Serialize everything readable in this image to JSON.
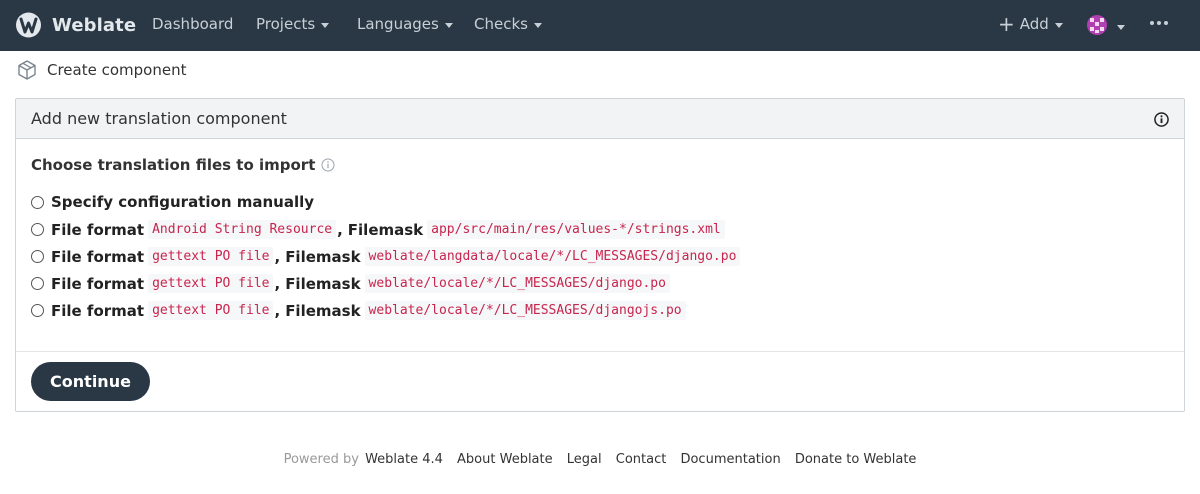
{
  "navbar": {
    "brand": "Weblate",
    "items": [
      {
        "label": "Dashboard",
        "dropdown": false
      },
      {
        "label": "Projects",
        "dropdown": true
      },
      {
        "label": "Languages",
        "dropdown": true
      },
      {
        "label": "Checks",
        "dropdown": true
      }
    ],
    "add_label": "Add",
    "colors": {
      "background": "#2a3744",
      "text": "#c8d0d7"
    }
  },
  "breadcrumb": {
    "label": "Create component",
    "icon": "cube-icon"
  },
  "panel": {
    "title": "Add new translation component",
    "heading": "Choose translation files to import",
    "options": [
      {
        "type": "manual",
        "label": "Specify configuration manually"
      },
      {
        "type": "file",
        "format_label": "File format",
        "format": "Android String Resource",
        "filemask_label": "Filemask",
        "filemask": "app/src/main/res/values-*/strings.xml"
      },
      {
        "type": "file",
        "format_label": "File format",
        "format": "gettext PO file",
        "filemask_label": "Filemask",
        "filemask": "weblate/langdata/locale/*/LC_MESSAGES/django.po"
      },
      {
        "type": "file",
        "format_label": "File format",
        "format": "gettext PO file",
        "filemask_label": "Filemask",
        "filemask": "weblate/locale/*/LC_MESSAGES/django.po"
      },
      {
        "type": "file",
        "format_label": "File format",
        "format": "gettext PO file",
        "filemask_label": "Filemask",
        "filemask": "weblate/locale/*/LC_MESSAGES/djangojs.po"
      }
    ],
    "continue_label": "Continue"
  },
  "footer": {
    "powered_by": "Powered by",
    "version": "Weblate 4.4",
    "links": [
      "About Weblate",
      "Legal",
      "Contact",
      "Documentation",
      "Donate to Weblate"
    ]
  }
}
